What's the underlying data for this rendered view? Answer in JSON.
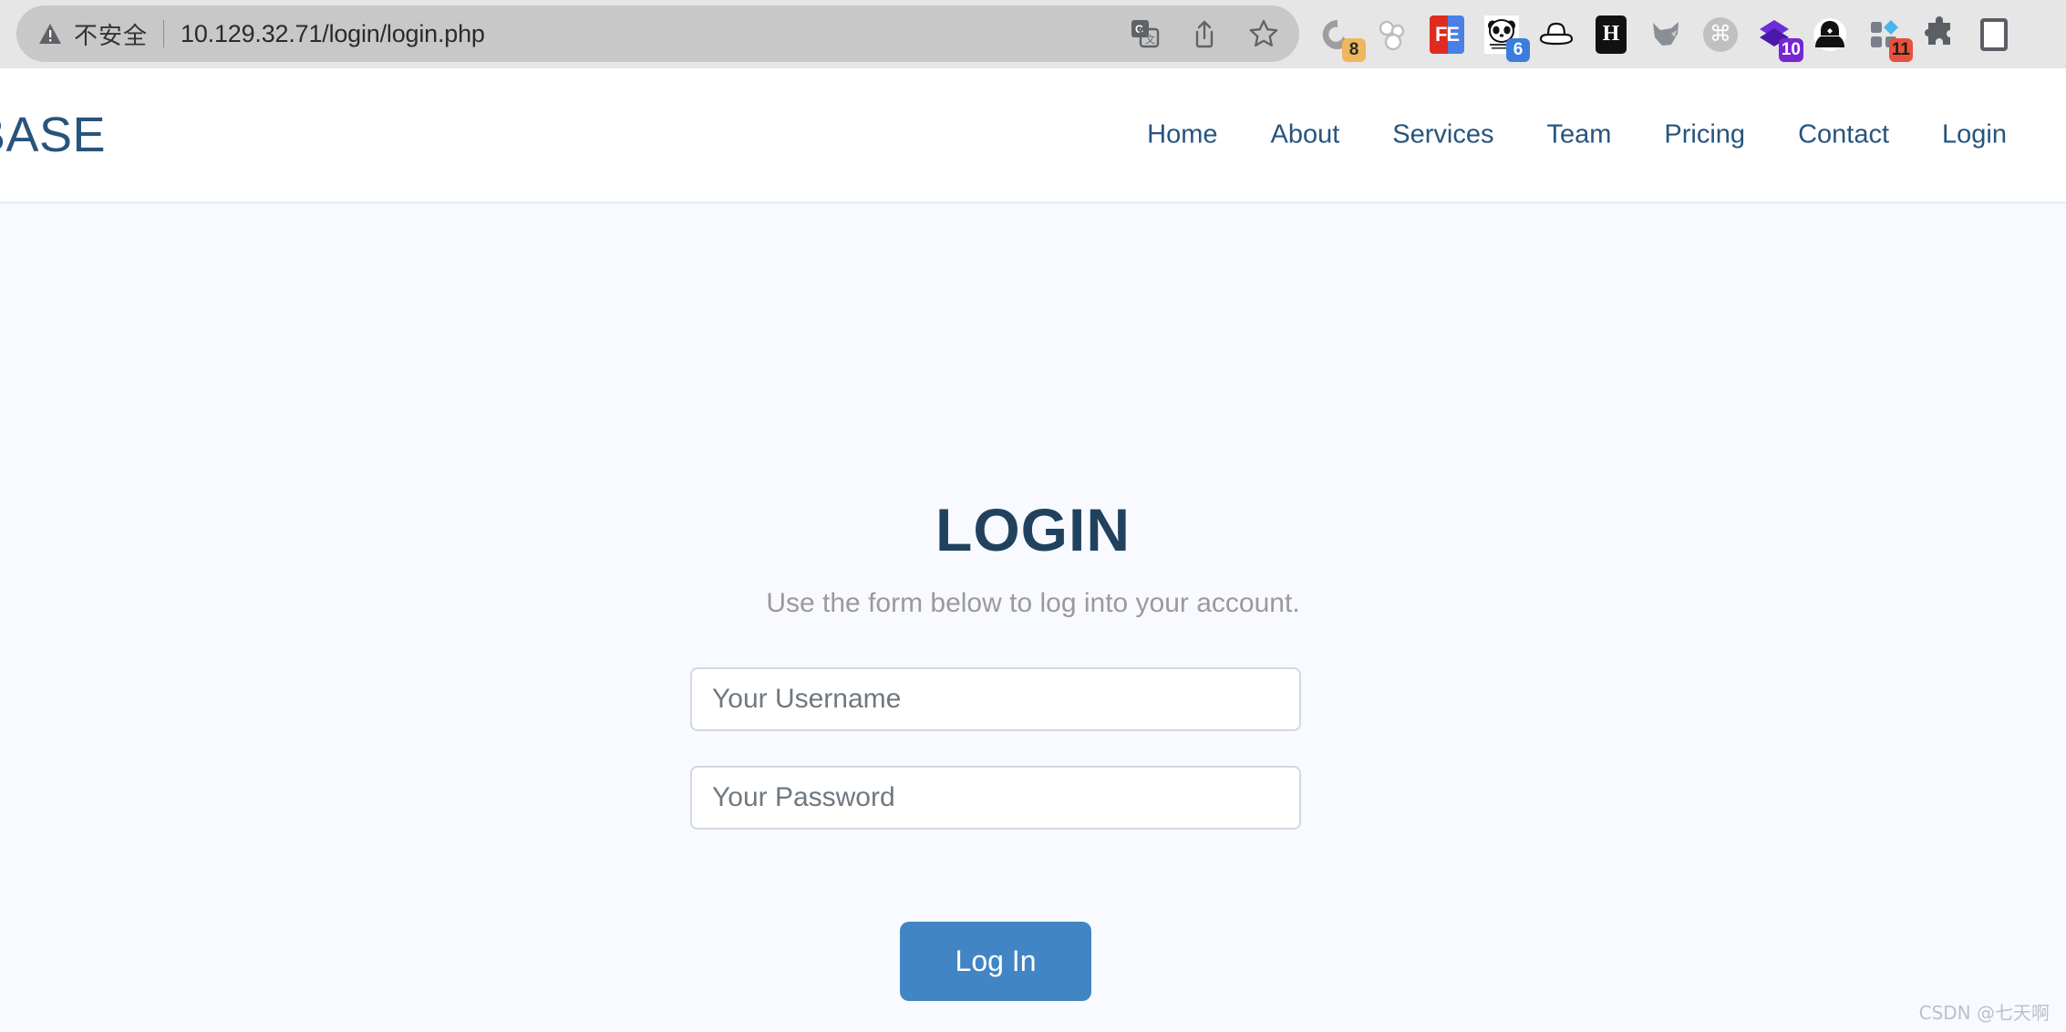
{
  "browser": {
    "security_label": "不安全",
    "url": "10.129.32.71/login/login.php",
    "omnibox_actions": [
      {
        "name": "translate-icon",
        "label": "Translate"
      },
      {
        "name": "share-icon",
        "label": "Share"
      },
      {
        "name": "bookmark-star-icon",
        "label": "Bookmark"
      }
    ],
    "extensions": [
      {
        "name": "c-ring-extension-icon",
        "badge": "8",
        "badge_color": "#eeb75c"
      },
      {
        "name": "molecule-extension-icon",
        "badge": ""
      },
      {
        "name": "fe-extension-icon",
        "label": "FE",
        "badge": ""
      },
      {
        "name": "panda-extension-icon",
        "badge": "6",
        "badge_color": "#3b7ddd"
      },
      {
        "name": "hat-extension-icon",
        "badge": ""
      },
      {
        "name": "h-extension-icon",
        "label": "H",
        "badge": ""
      },
      {
        "name": "wolf-extension-icon",
        "badge": ""
      },
      {
        "name": "command-extension-icon",
        "badge": ""
      },
      {
        "name": "purple-layers-extension-icon",
        "badge": "10",
        "badge_color": "#7527d4"
      },
      {
        "name": "hacker-extension-icon",
        "badge": ""
      },
      {
        "name": "grid-extension-icon",
        "badge": "11",
        "badge_color": "#e8513c"
      },
      {
        "name": "puzzle-extensions-icon",
        "badge": ""
      },
      {
        "name": "sidebar-toggle-icon",
        "badge": ""
      }
    ]
  },
  "site": {
    "logo_text": "BASE",
    "nav": [
      {
        "label": "Home"
      },
      {
        "label": "About"
      },
      {
        "label": "Services"
      },
      {
        "label": "Team"
      },
      {
        "label": "Pricing"
      },
      {
        "label": "Contact"
      },
      {
        "label": "Login"
      }
    ],
    "nav_color": "#27547c"
  },
  "login": {
    "title": "LOGIN",
    "subtitle": "Use the form below to log into your account.",
    "username": {
      "value": "",
      "placeholder": "Your Username"
    },
    "password": {
      "value": "",
      "placeholder": "Your Password"
    },
    "submit_label": "Log In",
    "title_color": "#21425e",
    "button_color": "#4285c4"
  },
  "watermark": "CSDN @七天啊"
}
